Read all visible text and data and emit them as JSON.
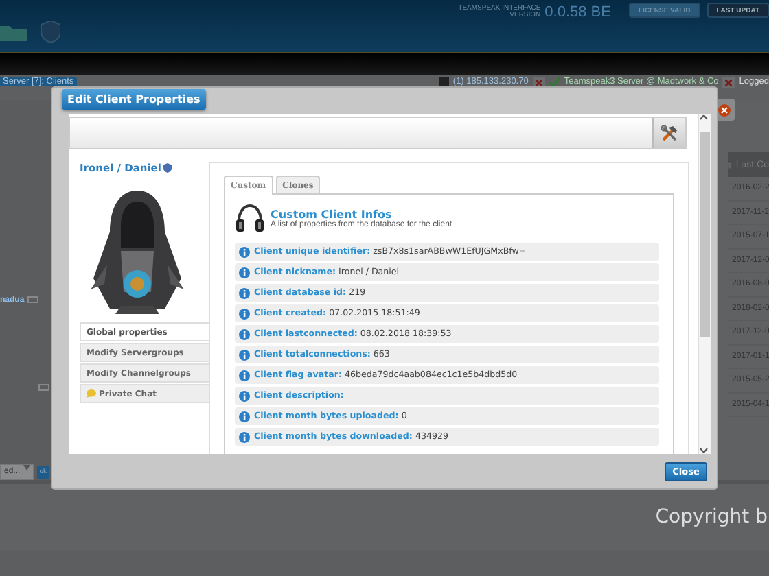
{
  "header": {
    "product_label": "TEAMSPEAK INTERFACE VERSION",
    "version": "0.0.58 BE",
    "buttons": [
      "LICENSE VALID",
      "LAST UPDAT"
    ]
  },
  "status_bar": {
    "tab": "Server [7]: Clients",
    "server_ip": "(1) 185.133.230.70",
    "server_name": "Teamspeak3 Server @ Madtwork & Co",
    "user": "Logged"
  },
  "background_table": {
    "column": "Last Co",
    "dates": [
      "2016-02-2",
      "2017-11-2",
      "2015-07-1",
      "2017-12-0",
      "2016-08-0",
      "2018-02-0",
      "2017-12-0",
      "2017-01-1",
      "2015-05-2",
      "2015-04-1"
    ],
    "left_name": "nadua",
    "select_value": "ed...",
    "ok_button": "ok"
  },
  "modal": {
    "title": "Edit Client Properties",
    "client_name": "Ironel / Daniel",
    "menu": [
      {
        "label": "Global properties",
        "kind": "page",
        "selected": true
      },
      {
        "label": "Modify Servergroups",
        "kind": "page",
        "selected": false
      },
      {
        "label": "Modify Channelgroups",
        "kind": "page",
        "selected": false
      },
      {
        "label": "Private Chat",
        "kind": "chat",
        "selected": false
      }
    ],
    "tabs": [
      {
        "label": "Custom",
        "selected": true
      },
      {
        "label": "Clones",
        "selected": false
      }
    ],
    "section_title": "Custom Client Infos",
    "section_subtitle": "A list of properties from the database for the client",
    "properties": [
      {
        "label": "Client unique identifier:",
        "value": "zsB7x8s1sarABBwW1EfUJGMxBfw="
      },
      {
        "label": "Client nickname:",
        "value": "Ironel / Daniel"
      },
      {
        "label": "Client database id:",
        "value": "219"
      },
      {
        "label": "Client created:",
        "value": "07.02.2015 18:51:49"
      },
      {
        "label": "Client lastconnected:",
        "value": "08.02.2018 18:39:53"
      },
      {
        "label": "Client totalconnections:",
        "value": "663"
      },
      {
        "label": "Client flag avatar:",
        "value": "46beda79dc4aab084ec1c1e5b4dbd5d0"
      },
      {
        "label": "Client description:"
      },
      {
        "label": "Client month bytes uploaded:",
        "value": "0"
      },
      {
        "label": "Client month bytes downloaded:",
        "value": "434929"
      }
    ],
    "close_button": "Close"
  },
  "footer": {
    "copyright": "Copyright b"
  }
}
